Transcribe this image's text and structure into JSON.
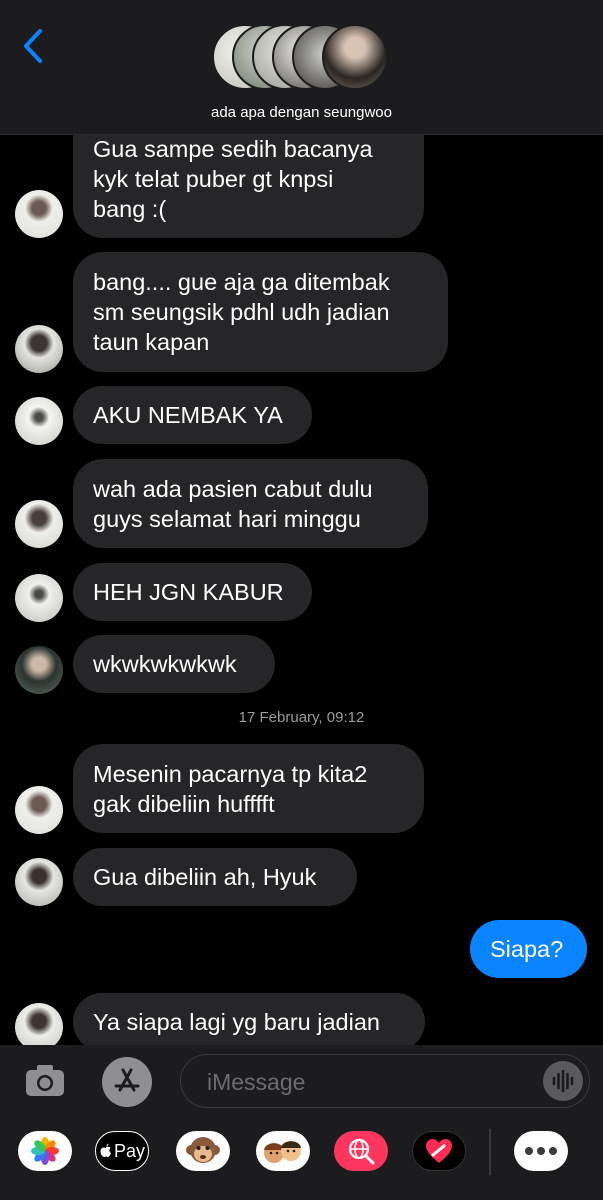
{
  "header": {
    "group_name": "ada apa dengan seungwoo"
  },
  "messages": [
    {
      "text": "Gua sampe sedih bacanya\nkyk telat puber gt knpsi\nbang :("
    },
    {
      "text": "bang.... gue aja ga ditembak\nsm seungsik pdhl udh jadian\ntaun kapan"
    },
    {
      "text": "AKU NEMBAK YA"
    },
    {
      "text": "wah ada pasien cabut dulu\nguys selamat hari minggu"
    },
    {
      "text": "HEH JGN KABUR"
    },
    {
      "text": "wkwkwkwkwk"
    },
    {
      "text": "Mesenin pacarnya tp kita2\ngak dibeliin hufffft"
    },
    {
      "text": "Gua dibeliin ah, Hyuk"
    },
    {
      "text": "Siapa?"
    },
    {
      "text": "Ya siapa lagi yg baru jadian"
    }
  ],
  "timestamp": "17 February, 09:12",
  "input": {
    "placeholder": "iMessage"
  },
  "apps": {
    "pay_label": "Pay"
  },
  "colors": {
    "incoming_bubble": "#262628",
    "outgoing_bubble": "#0b84ff",
    "accent": "#0a84ff"
  }
}
